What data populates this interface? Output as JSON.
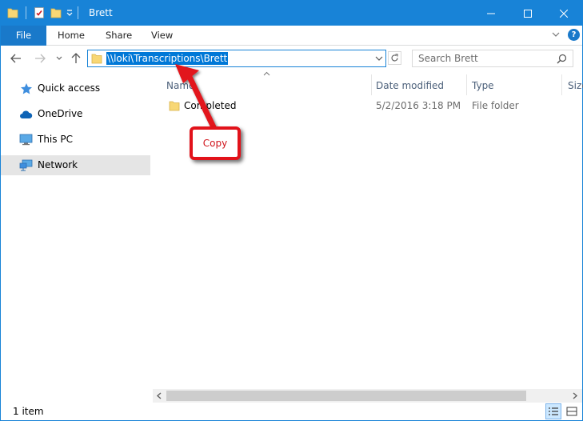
{
  "window": {
    "title": "Brett",
    "accent_color": "#1883d7",
    "selection_color": "#0078d7"
  },
  "ribbon": {
    "tabs": [
      {
        "label": "File"
      },
      {
        "label": "Home"
      },
      {
        "label": "Share"
      },
      {
        "label": "View"
      }
    ],
    "help_label": "?"
  },
  "nav": {
    "address_path": "\\\\loki\\Transcriptions\\Brett",
    "search_placeholder": "Search Brett"
  },
  "sidebar": {
    "items": [
      {
        "label": "Quick access",
        "icon": "star-icon"
      },
      {
        "label": "OneDrive",
        "icon": "cloud-icon"
      },
      {
        "label": "This PC",
        "icon": "computer-icon"
      },
      {
        "label": "Network",
        "icon": "network-icon",
        "selected": true
      }
    ]
  },
  "content": {
    "columns": [
      "Name",
      "Date modified",
      "Type",
      "Size"
    ],
    "rows": [
      {
        "name": "Completed",
        "date_modified": "5/2/2016 3:18 PM",
        "type": "File folder",
        "icon": "folder-icon"
      }
    ]
  },
  "status": {
    "item_count": "1 item"
  },
  "annotation": {
    "label": "Copy",
    "color": "#e2121a"
  }
}
